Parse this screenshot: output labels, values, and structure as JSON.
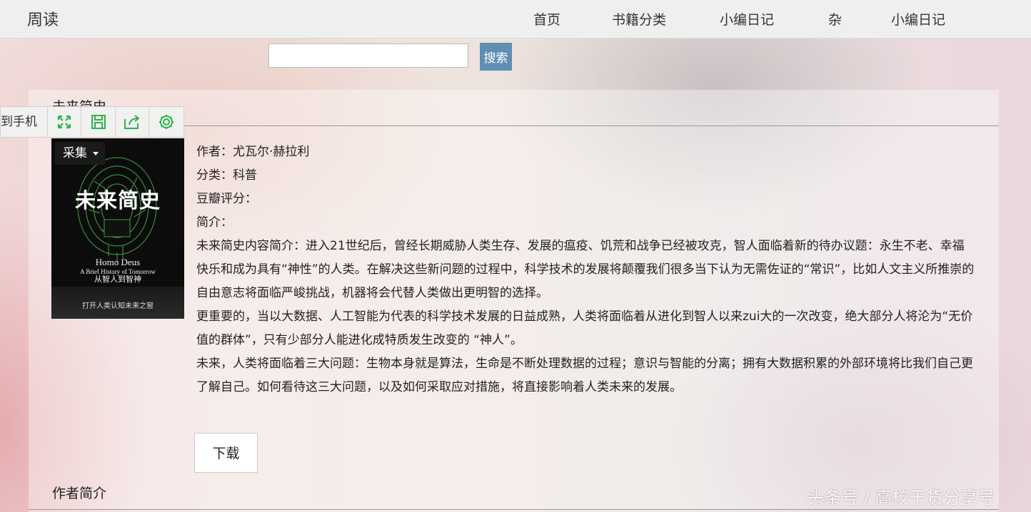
{
  "nav": {
    "brand": "周读",
    "items": [
      {
        "label": "首页"
      },
      {
        "label": "书籍分类"
      },
      {
        "label": "小编日记"
      },
      {
        "label": "杂"
      },
      {
        "label": "小编日记"
      }
    ]
  },
  "search": {
    "value": "",
    "button_label": "搜索"
  },
  "book": {
    "title": "未来简史",
    "author_line": "作者：尤瓦尔·赫拉利",
    "category_line": "分类：科普",
    "rating_line": "豆瓣评分：",
    "intro_label": "简介：",
    "paragraphs": [
      "未来简史内容简介：进入21世纪后，曾经长期威胁人类生存、发展的瘟疫、饥荒和战争已经被攻克，智人面临着新的待办议题：永生不老、幸福快乐和成为具有“神性”的人类。在解决这些新问题的过程中，科学技术的发展将颠覆我们很多当下认为无需佐证的“常识”，比如人文主义所推崇的自由意志将面临严峻挑战，机器将会代替人类做出更明智的选择。",
      "更重要的，当以大数据、人工智能为代表的科学技术发展的日益成熟，人类将面临着从进化到智人以来zui大的一次改变，绝大部分人将沦为“无价值的群体”，只有少部分人能进化成特质发生改变的 “神人”。",
      "未来，人类将面临着三大问题：生物本身就是算法，生命是不断处理数据的过程；意识与智能的分离；拥有大数据积累的外部环境将比我们自己更了解自己。如何看待这三大问题，以及如何采取应对措施，将直接影响着人类未来的发展。"
    ],
    "cover": {
      "title": "未来简史",
      "en_title": "Homo Deus",
      "en_subtitle": "A Brief History of Tomorrow",
      "cn_subtitle": "从智人到智神",
      "tagline": "打开人类认知未来之窗"
    }
  },
  "toolbar": {
    "send_to_phone_label": "到手机",
    "icons": [
      "fullscreen-icon",
      "save-icon",
      "share-icon",
      "settings-icon"
    ],
    "icon_color": "#2db34a",
    "collect_label": "采集"
  },
  "download_label": "下载",
  "author_intro_label": "作者简介",
  "watermark": "头条号 / 高校干货分享号"
}
